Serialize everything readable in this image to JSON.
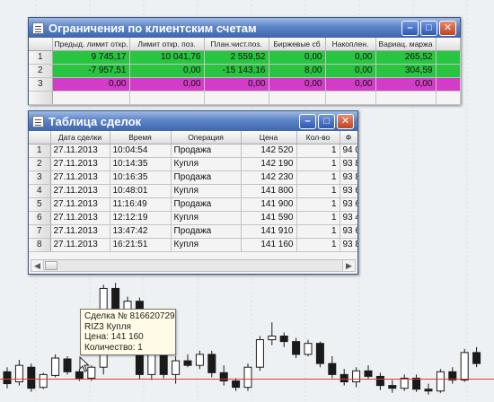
{
  "limits_window": {
    "title": "Ограничения по клиентским счетам",
    "columns": [
      "Предыд. лимит откр. поз.",
      "Лимит откр. поз.",
      "План.чист.поз.",
      "Биржевые сб",
      "Накоплен.",
      "Вариац. маржа"
    ],
    "rows": [
      {
        "num": "1",
        "cells": [
          "9 745,17",
          "10 041,76",
          "2 559,52",
          "0,00",
          "0,00",
          "265,52"
        ],
        "color": "green"
      },
      {
        "num": "2",
        "cells": [
          "-7 957,51",
          "0,00",
          "-15 143,16",
          "8,00",
          "0,00",
          "304,59"
        ],
        "color": "green"
      },
      {
        "num": "3",
        "cells": [
          "0,00",
          "0,00",
          "0,00",
          "0,00",
          "0,00",
          "0,00"
        ],
        "color": "magenta"
      }
    ]
  },
  "deals_window": {
    "title": "Таблица сделок",
    "columns": [
      "Дата сделки",
      "Время",
      "Операция",
      "Цена",
      "Кол-во",
      "Ф"
    ],
    "rows": [
      {
        "num": "1",
        "date": "27.11.2013",
        "time": "10:04:54",
        "op": "Продажа",
        "price": "142 520",
        "qty": "1",
        "extra": "94 0"
      },
      {
        "num": "2",
        "date": "27.11.2013",
        "time": "10:14:35",
        "op": "Купля",
        "price": "142 190",
        "qty": "1",
        "extra": "93 8"
      },
      {
        "num": "3",
        "date": "27.11.2013",
        "time": "10:16:35",
        "op": "Продажа",
        "price": "142 230",
        "qty": "1",
        "extra": "93 8"
      },
      {
        "num": "4",
        "date": "27.11.2013",
        "time": "10:48:01",
        "op": "Купля",
        "price": "141 800",
        "qty": "1",
        "extra": "93 6"
      },
      {
        "num": "5",
        "date": "27.11.2013",
        "time": "11:16:49",
        "op": "Продажа",
        "price": "141 900",
        "qty": "1",
        "extra": "93 6"
      },
      {
        "num": "6",
        "date": "27.11.2013",
        "time": "12:12:19",
        "op": "Купля",
        "price": "141 590",
        "qty": "1",
        "extra": "93 4"
      },
      {
        "num": "7",
        "date": "27.11.2013",
        "time": "13:47:42",
        "op": "Продажа",
        "price": "141 910",
        "qty": "1",
        "extra": "93 6"
      },
      {
        "num": "8",
        "date": "27.11.2013",
        "time": "16:21:51",
        "op": "Купля",
        "price": "141 160",
        "qty": "1",
        "extra": "93 8"
      }
    ]
  },
  "tooltip": {
    "line1": "Сделка № 816620729",
    "line2": "RIZ3 Купля",
    "line3": "Цена: 141 160",
    "line4": "Количество: 1"
  },
  "chart_data": {
    "type": "candlestick",
    "candles": [
      {
        "o": 141330,
        "h": 141380,
        "l": 141150,
        "c": 141200
      },
      {
        "o": 141220,
        "h": 141460,
        "l": 141180,
        "c": 141400
      },
      {
        "o": 141380,
        "h": 141420,
        "l": 141110,
        "c": 141150
      },
      {
        "o": 141160,
        "h": 141320,
        "l": 141140,
        "c": 141300
      },
      {
        "o": 141290,
        "h": 141520,
        "l": 141270,
        "c": 141480
      },
      {
        "o": 141470,
        "h": 141500,
        "l": 141300,
        "c": 141330
      },
      {
        "o": 141330,
        "h": 141360,
        "l": 141230,
        "c": 141260
      },
      {
        "o": 141260,
        "h": 141400,
        "l": 141230,
        "c": 141380
      },
      {
        "o": 141380,
        "h": 142280,
        "l": 141300,
        "c": 142240
      },
      {
        "o": 142240,
        "h": 142300,
        "l": 141880,
        "c": 141920
      },
      {
        "o": 141920,
        "h": 142150,
        "l": 141820,
        "c": 142100
      },
      {
        "o": 142100,
        "h": 142140,
        "l": 141250,
        "c": 141300
      },
      {
        "o": 141300,
        "h": 141580,
        "l": 141240,
        "c": 141520
      },
      {
        "o": 141520,
        "h": 141560,
        "l": 141260,
        "c": 141300
      },
      {
        "o": 141300,
        "h": 141500,
        "l": 141200,
        "c": 141450
      },
      {
        "o": 141450,
        "h": 141520,
        "l": 141380,
        "c": 141400
      },
      {
        "o": 141400,
        "h": 141560,
        "l": 141360,
        "c": 141520
      },
      {
        "o": 141520,
        "h": 141560,
        "l": 141270,
        "c": 141320
      },
      {
        "o": 141320,
        "h": 141400,
        "l": 141180,
        "c": 141230
      },
      {
        "o": 141230,
        "h": 141260,
        "l": 141120,
        "c": 141160
      },
      {
        "o": 141160,
        "h": 141420,
        "l": 141120,
        "c": 141380
      },
      {
        "o": 141380,
        "h": 141720,
        "l": 141340,
        "c": 141680
      },
      {
        "o": 141680,
        "h": 141870,
        "l": 141620,
        "c": 141720
      },
      {
        "o": 141720,
        "h": 141760,
        "l": 141600,
        "c": 141660
      },
      {
        "o": 141660,
        "h": 141700,
        "l": 141480,
        "c": 141520
      },
      {
        "o": 141520,
        "h": 141680,
        "l": 141500,
        "c": 141640
      },
      {
        "o": 141640,
        "h": 141660,
        "l": 141380,
        "c": 141420
      },
      {
        "o": 141420,
        "h": 141500,
        "l": 141260,
        "c": 141300
      },
      {
        "o": 141300,
        "h": 141360,
        "l": 141180,
        "c": 141220
      },
      {
        "o": 141220,
        "h": 141380,
        "l": 141160,
        "c": 141340
      },
      {
        "o": 141340,
        "h": 141400,
        "l": 141250,
        "c": 141280
      },
      {
        "o": 141280,
        "h": 141320,
        "l": 141130,
        "c": 141180
      },
      {
        "o": 141180,
        "h": 141240,
        "l": 141100,
        "c": 141150
      },
      {
        "o": 141150,
        "h": 141300,
        "l": 141120,
        "c": 141260
      },
      {
        "o": 141260,
        "h": 141300,
        "l": 141110,
        "c": 141140
      },
      {
        "o": 141140,
        "h": 141200,
        "l": 141080,
        "c": 141120
      },
      {
        "o": 141120,
        "h": 141360,
        "l": 141100,
        "c": 141330
      },
      {
        "o": 141330,
        "h": 141380,
        "l": 141200,
        "c": 141240
      },
      {
        "o": 141240,
        "h": 141580,
        "l": 141220,
        "c": 141540
      },
      {
        "o": 141540,
        "h": 141600,
        "l": 141380,
        "c": 141420
      }
    ],
    "price_line": 141250,
    "colors": {
      "up": "#ffffff",
      "down": "#1a1a1a",
      "line": "#e03a3a",
      "grid": "#c8ccd2"
    }
  }
}
